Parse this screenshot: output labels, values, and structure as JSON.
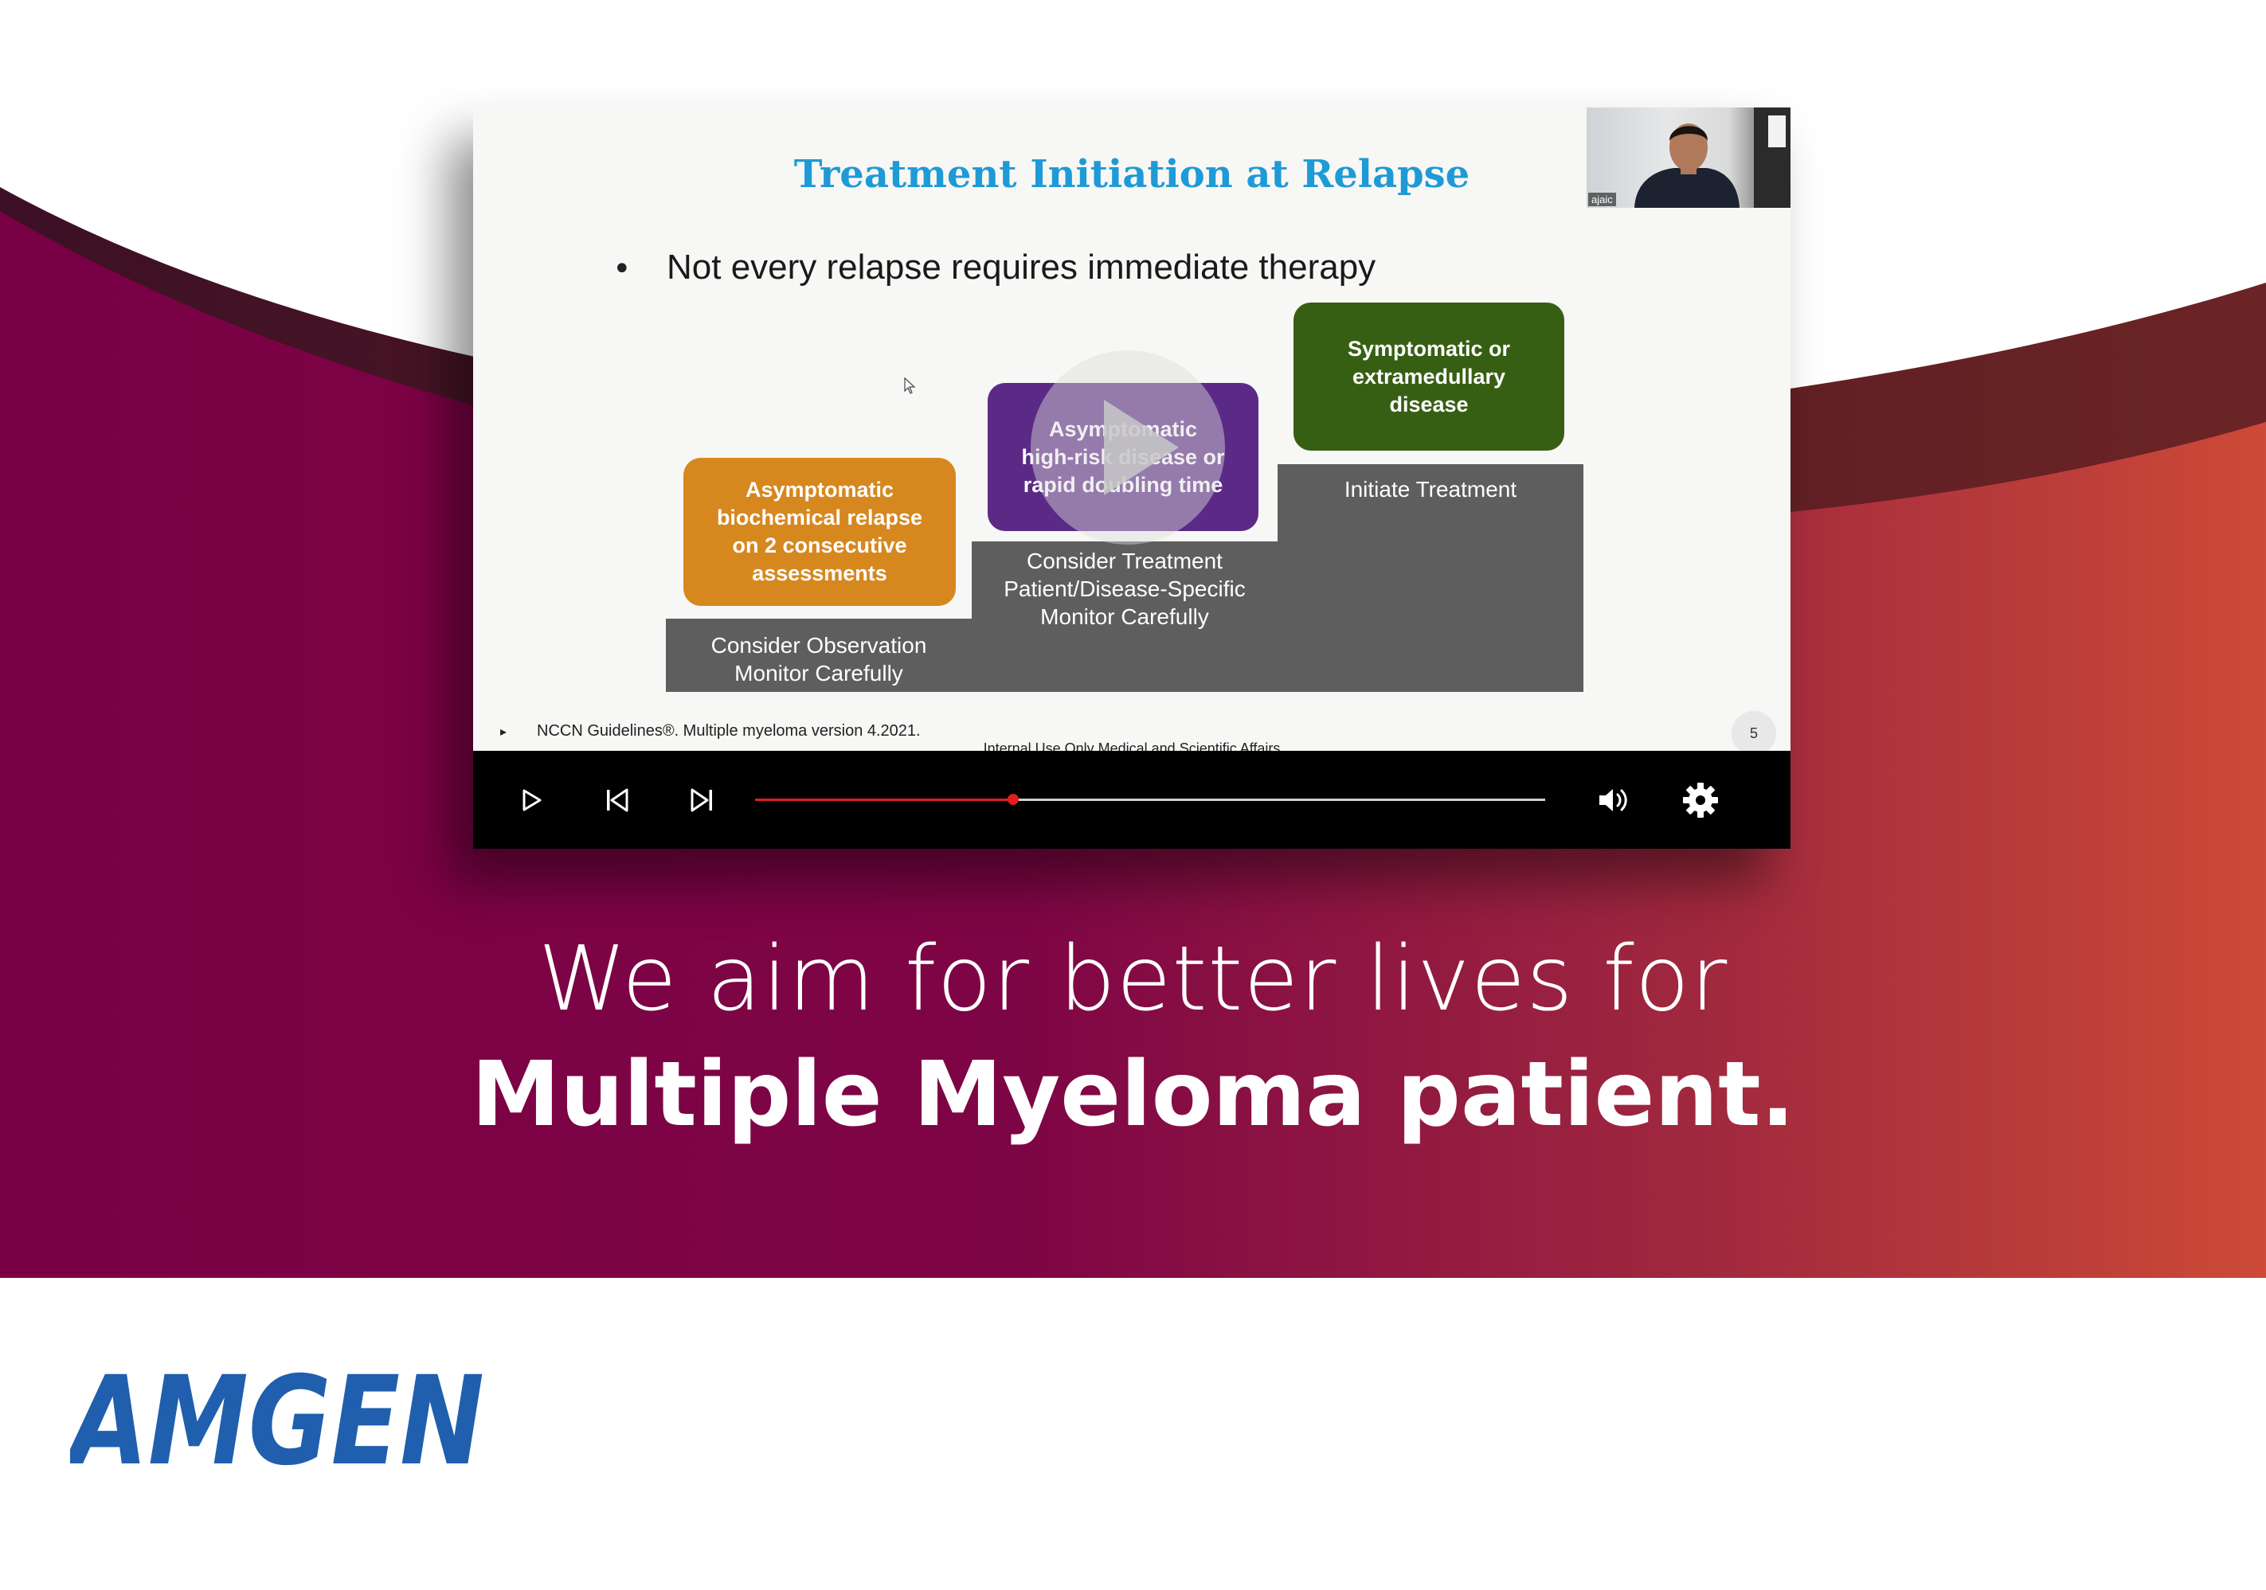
{
  "brand": {
    "primary_color": "#7a0045",
    "accent_color": "#c8453a",
    "logo_color": "#1f5fae"
  },
  "slide": {
    "title": "Treatment Initiation at Relapse",
    "bullet": "Not every relapse requires immediate therapy",
    "boxes": {
      "orange": [
        "Asymptomatic",
        "biochemical relapse",
        "on 2 consecutive",
        "assessments"
      ],
      "purple": [
        "Asymptomatic",
        "high-risk disease or",
        "rapid doubling time"
      ],
      "green": [
        "Symptomatic or",
        "extramedullary",
        "disease"
      ]
    },
    "steps": {
      "low": [
        "Consider Observation",
        "Monitor Carefully"
      ],
      "mid": [
        "Consider Treatment",
        "Patient/Disease-Specific",
        "Monitor Carefully"
      ],
      "high": [
        "Initiate Treatment"
      ]
    },
    "footnote": "NCCN Guidelines®. Multiple myeloma version 4.2021.",
    "internal_note": "Internal Use Only Medical and Scientific Affairs",
    "slide_number": "5",
    "webcam_name": "ajaic"
  },
  "player": {
    "progress_fraction": 0.327,
    "icons": [
      "play-icon",
      "skip-previous-icon",
      "skip-next-icon",
      "volume-icon",
      "settings-gear-icon",
      "big-play-icon"
    ]
  },
  "headline": {
    "line1": "We aim for better lives for",
    "line2": "Multiple Myeloma patient."
  },
  "logo": {
    "text": "AMGEN"
  }
}
